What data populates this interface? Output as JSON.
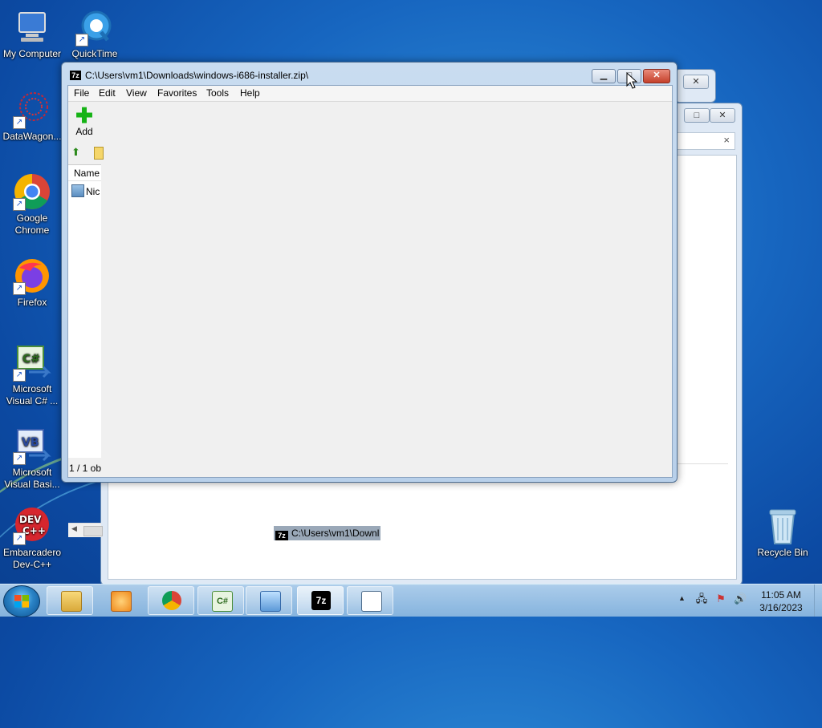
{
  "desktop": {
    "icons": [
      {
        "label": "My Computer"
      },
      {
        "label": "QuickTime"
      },
      {
        "label": "DataWagon..."
      },
      {
        "label": "Google Chrome"
      },
      {
        "label": "Firefox"
      },
      {
        "label": "Microsoft Visual C# ..."
      },
      {
        "label": "Microsoft Visual Basi..."
      },
      {
        "label": "Embarcadero Dev-C++"
      },
      {
        "label": "Recycle Bin"
      }
    ]
  },
  "window": {
    "title": "C:\\Users\\vm1\\Downloads\\windows-i686-installer.zip\\",
    "app_icon": "7z",
    "controls": {
      "minimize": "▁",
      "maximize": "□",
      "close": "✕"
    },
    "menu": [
      "File",
      "Edit",
      "View",
      "Favorites",
      "Tools",
      "Help"
    ],
    "toolbar": {
      "add_label": "Add"
    },
    "filelist": {
      "column_name": "Name",
      "rows": [
        {
          "name": "Nic"
        }
      ]
    },
    "status": "1 / 1 ob"
  },
  "back_window": {
    "search_clear": "×"
  },
  "drag_tooltip": {
    "icon": "7z",
    "text": "C:\\Users\\vm1\\Downl"
  },
  "taskbar": {
    "apps": [
      "file-explorer",
      "media-player",
      "google-chrome",
      "visual-csharp",
      "control-panel",
      "7-zip",
      "list-app"
    ],
    "clock": {
      "time": "11:05 AM",
      "date": "3/16/2023"
    }
  }
}
